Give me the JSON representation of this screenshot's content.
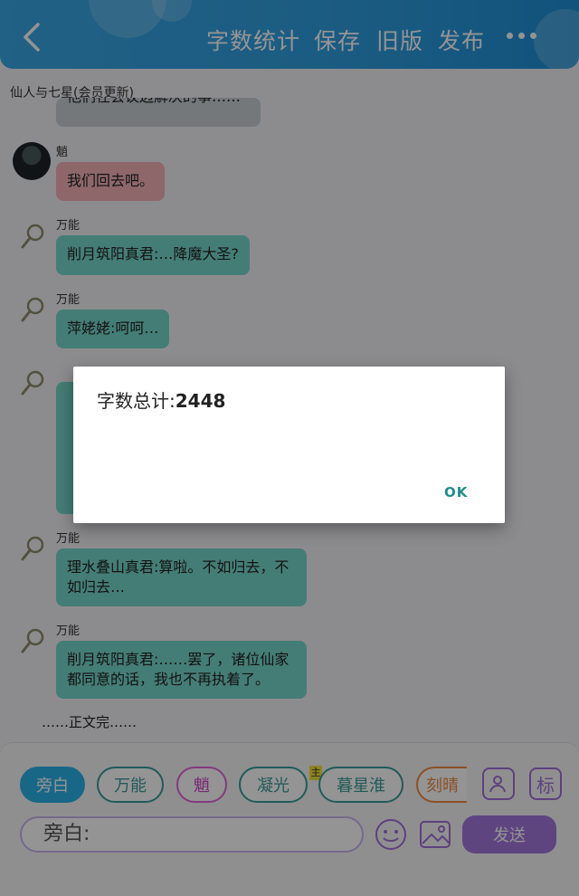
{
  "header": {
    "items": [
      "字数统计",
      "保存",
      "旧版",
      "发布"
    ]
  },
  "story_title": "仙人与七星(会员更新)",
  "messages": [
    {
      "name": "",
      "text": "他们在会议边解决的事……"
    },
    {
      "name": "魈",
      "text": "我们回去吧。"
    },
    {
      "name": "万能",
      "text": "削月筑阳真君:…降魔大圣?"
    },
    {
      "name": "万能",
      "text": "萍姥姥:呵呵…"
    },
    {
      "name": "万能",
      "text": "理水叠山真君:算啦。不如归去，不如归去…"
    },
    {
      "name": "万能",
      "text": "削月筑阳真君:……罢了，诸位仙家都同意的话，我也不再执着了。"
    }
  ],
  "narration": "……正文完……",
  "chips": [
    "旁白",
    "万能",
    "魈",
    "凝光",
    "暮星淮",
    "刻晴"
  ],
  "main_tag": "主",
  "biao_label": "标",
  "input_value": "旁白:",
  "send_label": "发送",
  "dialog": {
    "label": "字数总计:",
    "value": "2448",
    "ok_label": "OK"
  },
  "colors": {
    "header": "#2f9ee0",
    "bubble_teal": "#76d7cc",
    "bubble_pink": "#f5b2b8",
    "send": "#a277dc",
    "ok": "#1f8f86"
  }
}
